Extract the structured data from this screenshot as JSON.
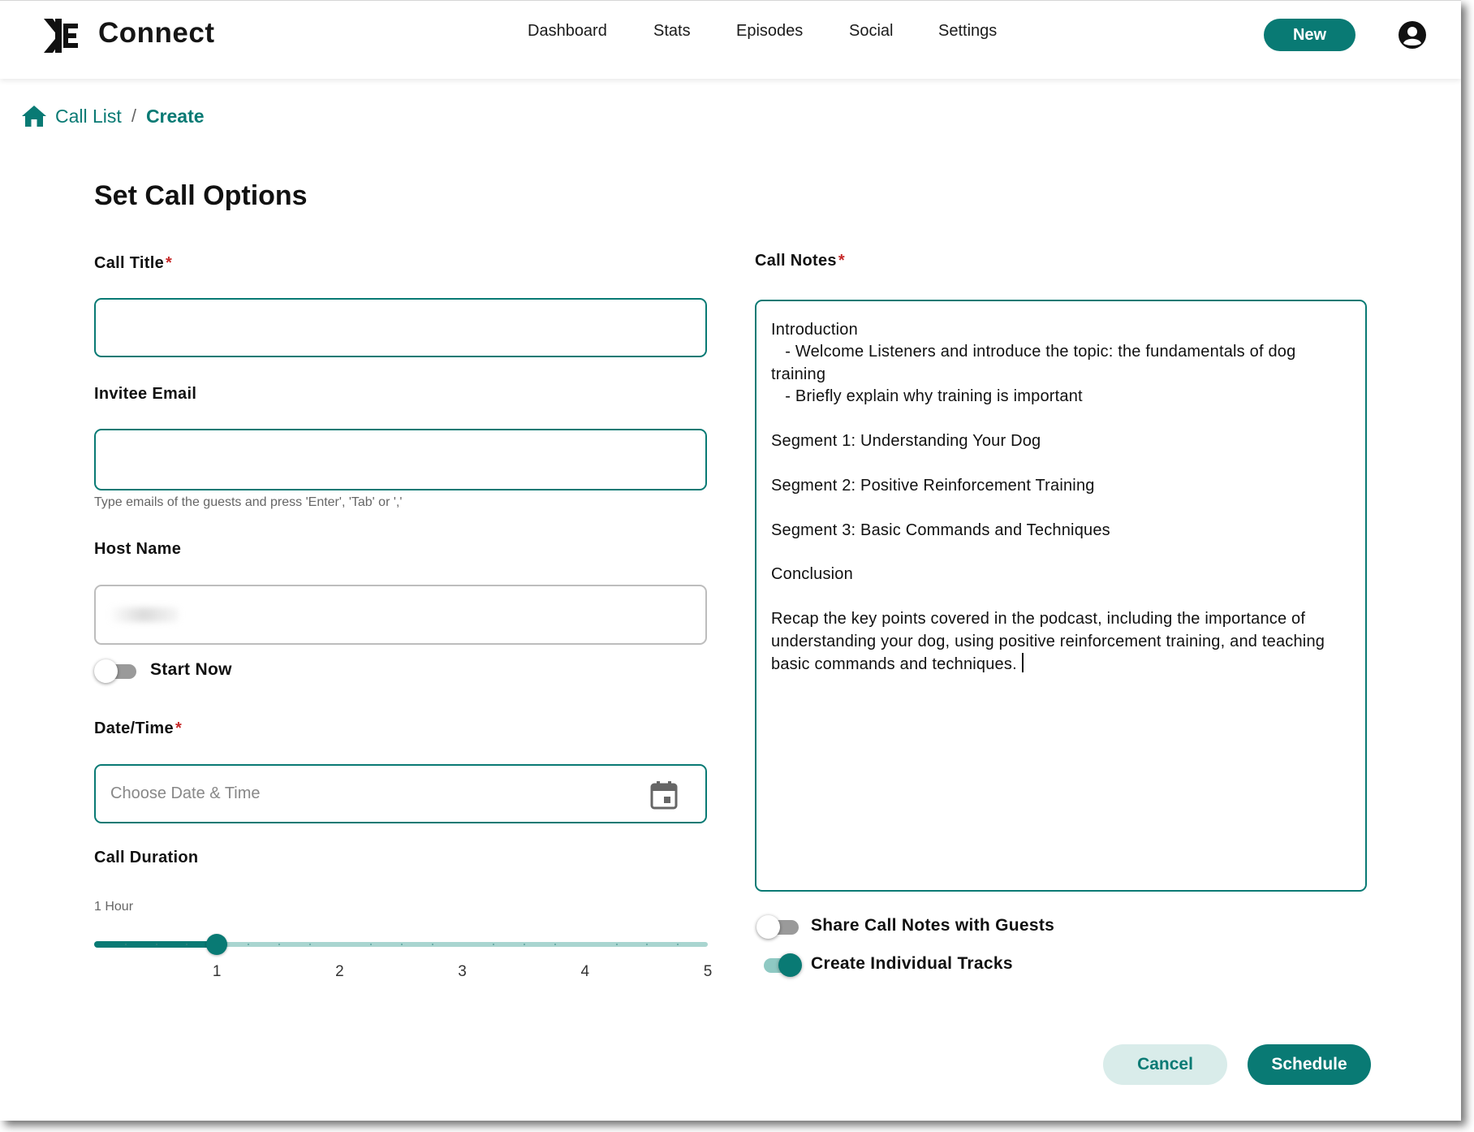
{
  "header": {
    "brand": "Connect",
    "nav": [
      "Dashboard",
      "Stats",
      "Episodes",
      "Social",
      "Settings"
    ],
    "new_button": "New",
    "logo_icon": "connect-logo-icon",
    "account_icon": "account-circle-icon"
  },
  "breadcrumb": {
    "home_icon": "home-icon",
    "link": "Call List",
    "separator": "/",
    "current": "Create"
  },
  "page_title": "Set Call Options",
  "form": {
    "call_title": {
      "label": "Call Title",
      "required_mark": "*",
      "value": ""
    },
    "invitee_email": {
      "label": "Invitee Email",
      "value": "",
      "helper": "Type emails of the guests and press 'Enter', 'Tab' or ','"
    },
    "host_name": {
      "label": "Host Name"
    },
    "start_now": {
      "label": "Start Now",
      "checked": false
    },
    "date_time": {
      "label": "Date/Time",
      "required_mark": "*",
      "placeholder": "Choose Date & Time",
      "icon": "calendar-icon"
    },
    "call_duration": {
      "label": "Call Duration",
      "value_text": "1 Hour",
      "value": 1,
      "min": 0,
      "max": 5,
      "tick_labels": [
        "1",
        "2",
        "3",
        "4",
        "5"
      ]
    }
  },
  "notes": {
    "label": "Call Notes",
    "required_mark": "*",
    "text": "Introduction\n   - Welcome Listeners and introduce the topic: the fundamentals of dog training\n   - Briefly explain why training is important\n\nSegment 1: Understanding Your Dog\n\nSegment 2: Positive Reinforcement Training\n\nSegment 3: Basic Commands and Techniques\n\nConclusion\n\nRecap the key points covered in the podcast, including the importance of understanding your dog, using positive reinforcement training, and teaching basic commands and techniques."
  },
  "toggles": {
    "share_notes": {
      "label": "Share Call Notes with Guests",
      "checked": false
    },
    "individual_tracks": {
      "label": "Create Individual Tracks",
      "checked": true
    }
  },
  "actions": {
    "cancel": "Cancel",
    "schedule": "Schedule"
  },
  "colors": {
    "accent": "#097a74",
    "accent_light": "#a9d5d0",
    "required": "#c62828"
  }
}
